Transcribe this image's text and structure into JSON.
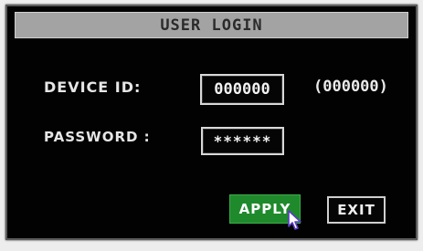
{
  "dialog": {
    "title": "USER LOGIN"
  },
  "form": {
    "device_id_label": "DEVICE ID:",
    "device_id_value": "000000",
    "device_id_hint": "(000000)",
    "password_label": "PASSWORD :",
    "password_value": "******"
  },
  "buttons": {
    "apply_label": "APPLY",
    "exit_label": "EXIT"
  },
  "colors": {
    "apply_background": "#1e8a2c",
    "title_bar": "#a3a3a3",
    "dialog_background": "#020202"
  },
  "icons": {
    "cursor": "mouse-pointer-icon"
  }
}
